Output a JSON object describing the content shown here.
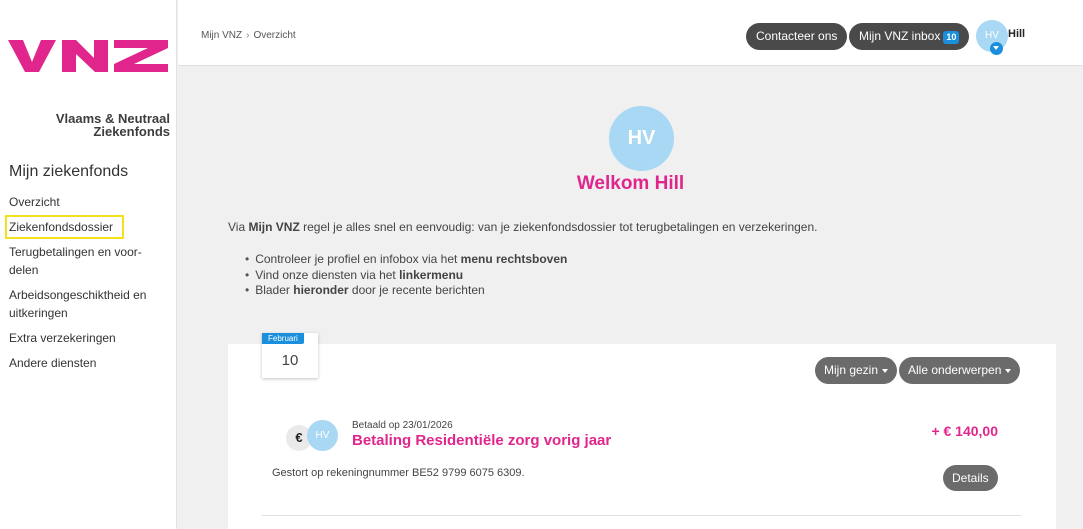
{
  "logo": {
    "line1": "Vlaams & Neutraal",
    "line2": "Ziekenfonds"
  },
  "sidebar": {
    "title": "Mijn ziekenfonds",
    "items": [
      {
        "label": "Overzicht"
      },
      {
        "label": "Ziekenfondsdossier"
      },
      {
        "label": "Terugbetalingen en voor-delen"
      },
      {
        "label": "Arbeidsongeschiktheid en uitkeringen"
      },
      {
        "label": "Extra verzekeringen"
      },
      {
        "label": "Andere diensten"
      }
    ]
  },
  "breadcrumb": [
    "Mijn VNZ",
    "Overzicht"
  ],
  "header": {
    "contact_label": "Contacteer ons",
    "inbox_label": "Mijn VNZ inbox",
    "inbox_count": "10",
    "avatar_initials": "HV",
    "user_name": "Hill"
  },
  "welcome": {
    "avatar_initials": "HV",
    "title": "Welkom Hill",
    "intro_pre": "Via ",
    "intro_bold": "Mijn VNZ",
    "intro_post": " regel je alles snel en eenvoudig: van je ziekenfondsdossier tot terugbetalingen en verzekeringen.",
    "bullets": [
      {
        "pre": "Controleer je profiel en infobox via het ",
        "bold": "menu rechtsboven",
        "post": ""
      },
      {
        "pre": "Vind onze diensten via het ",
        "bold": "linkermenu",
        "post": ""
      },
      {
        "pre": "Blader ",
        "bold": "hieronder",
        "post": " door je recente berichten"
      }
    ]
  },
  "feed": {
    "date_month": "Februari",
    "date_day": "10",
    "filter_family": "Mijn gezin",
    "filter_topics": "Alle onderwerpen",
    "message": {
      "icon": "€",
      "avatar_initials": "HV",
      "meta": "Betaald op 23/01/2026",
      "title": "Betaling Residentiële zorg vorig jaar",
      "amount": "+ € 140,00",
      "text": "Gestort op rekeningnummer BE52 9799 6075 6309.",
      "details_label": "Details"
    }
  },
  "colors": {
    "brand_pink": "#e0268d",
    "accent_blue": "#1a8fdd",
    "avatar_blue": "#a8d8f4",
    "highlight_yellow": "#f5e11b"
  }
}
